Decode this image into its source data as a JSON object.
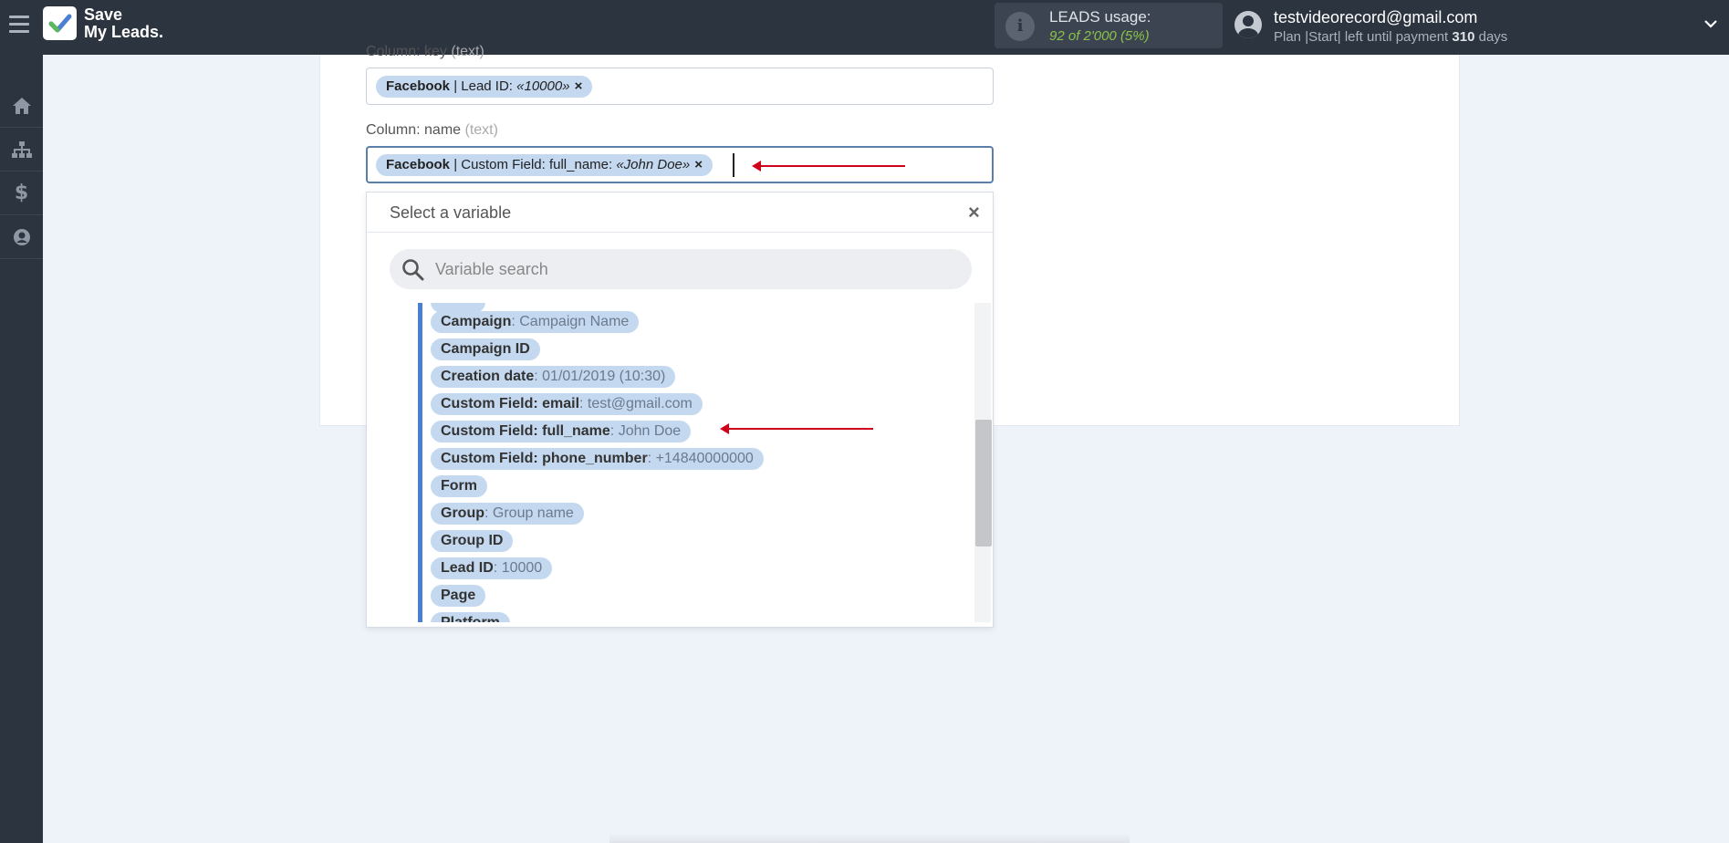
{
  "header": {
    "logo_line1": "Save",
    "logo_line2": "My Leads.",
    "usage_label": "LEADS usage:",
    "usage_count": "92 of 2'000",
    "usage_percent": "(5%)",
    "user_email": "testvideorecord@gmail.com",
    "plan_prefix": "Plan |Start| left until payment",
    "plan_days": "310",
    "plan_suffix": "days"
  },
  "sidebar": {
    "items": [
      {
        "icon": "home-icon"
      },
      {
        "icon": "sitemap-icon"
      },
      {
        "icon": "dollar-icon"
      },
      {
        "icon": "user-circle-icon"
      }
    ]
  },
  "form": {
    "key_label": "Column: key",
    "key_hint": "(text)",
    "key_tag": {
      "source": "Facebook",
      "field": "| Lead ID:",
      "value": "«10000»",
      "remove": "×"
    },
    "name_label": "Column: name",
    "name_hint": "(text)",
    "name_tag": {
      "source": "Facebook",
      "field": "| Custom Field: full_name:",
      "value": "«John Doe»",
      "remove": "×"
    }
  },
  "dropdown": {
    "title": "Select a variable",
    "close": "×",
    "search_placeholder": "Variable search",
    "items": [
      {
        "name": "Campaign",
        "value": ": Campaign Name"
      },
      {
        "name": "Campaign ID",
        "value": ""
      },
      {
        "name": "Creation date",
        "value": ": 01/01/2019 (10:30)"
      },
      {
        "name": "Custom Field: email",
        "value": ": test@gmail.com"
      },
      {
        "name": "Custom Field: full_name",
        "value": ": John Doe"
      },
      {
        "name": "Custom Field: phone_number",
        "value": ": +14840000000"
      },
      {
        "name": "Form",
        "value": ""
      },
      {
        "name": "Group",
        "value": ": Group name"
      },
      {
        "name": "Group ID",
        "value": ""
      },
      {
        "name": "Lead ID",
        "value": ": 10000"
      },
      {
        "name": "Page",
        "value": ""
      },
      {
        "name": "Platform",
        "value": ""
      }
    ]
  },
  "colors": {
    "topbar": "#2c3440",
    "tag_bg": "#c4d8ef",
    "accent_arrow": "#d0021b",
    "usage_green": "#8bc34a"
  }
}
